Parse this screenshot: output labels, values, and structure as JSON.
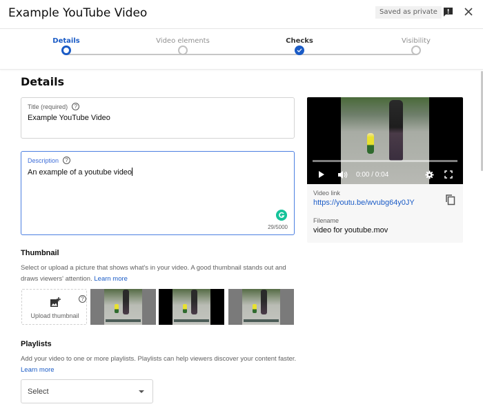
{
  "header": {
    "title": "Example YouTube Video",
    "saved_status": "Saved as private",
    "feedback_icon": "feedback-icon",
    "close_icon": "close-icon"
  },
  "stepper": {
    "steps": [
      {
        "label": "Details",
        "state": "active"
      },
      {
        "label": "Video elements",
        "state": "pending"
      },
      {
        "label": "Checks",
        "state": "checked"
      },
      {
        "label": "Visibility",
        "state": "pending"
      }
    ]
  },
  "details": {
    "heading": "Details",
    "title_field": {
      "label": "Title (required)",
      "value": "Example YouTube Video"
    },
    "description_field": {
      "label": "Description",
      "value": "An example of a youtube video",
      "counter": "29/5000"
    }
  },
  "video": {
    "time": "0:00 / 0:04",
    "link_label": "Video link",
    "link": "https://youtu.be/wvubg64y0JY",
    "filename_label": "Filename",
    "filename": "video for youtube.mov"
  },
  "thumbnail": {
    "heading": "Thumbnail",
    "description": "Select or upload a picture that shows what's in your video. A good thumbnail stands out and draws viewers' attention.",
    "learn_more": "Learn more",
    "upload_label": "Upload thumbnail",
    "options": [
      {
        "selected": false
      },
      {
        "selected": true
      },
      {
        "selected": false
      }
    ]
  },
  "playlists": {
    "heading": "Playlists",
    "description": "Add your video to one or more playlists. Playlists can help viewers discover your content faster.",
    "learn_more": "Learn more",
    "select_value": "Select"
  },
  "colors": {
    "accent": "#1a5bc6",
    "grammarly": "#15c39a"
  }
}
